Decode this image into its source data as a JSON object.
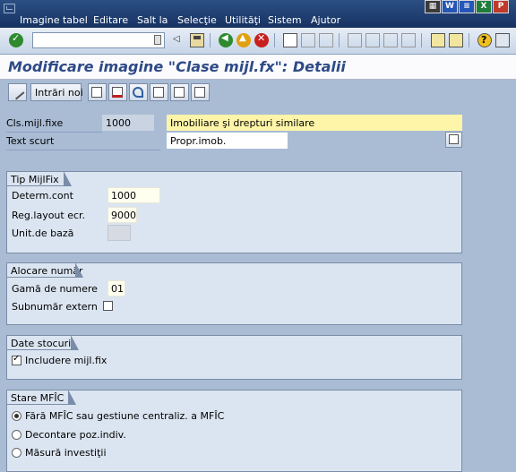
{
  "menu": {
    "items": [
      "Imagine tabel",
      "Editare",
      "Salt la",
      "Selecţie",
      "Utilităţi",
      "Sistem",
      "Ajutor"
    ]
  },
  "toolbar": {
    "command_value": ""
  },
  "title": "Modificare imagine \"Clase mijl.fx\": Detalii",
  "app_toolbar": {
    "new_entries_label": "Intrări noi"
  },
  "header": {
    "cls_label": "Cls.mijl.fixe",
    "cls_value": "1000",
    "cls_desc": "Imobiliare şi drepturi similare",
    "short_text_label": "Text scurt",
    "short_text_value": "Propr.imob."
  },
  "groups": {
    "tip": {
      "title": "Tip MijlFix",
      "determ_label": "Determ.cont",
      "determ_value": "1000",
      "layout_label": "Reg.layout ecr.",
      "layout_value": "9000",
      "unit_label": "Unit.de bază",
      "unit_value": ""
    },
    "alocare": {
      "title": "Alocare număr",
      "gama_label": "Gamă de numere",
      "gama_value": "01",
      "sub_label": "Subnumăr extern",
      "sub_checked": false
    },
    "stocuri": {
      "title": "Date stocuri",
      "include_label": "Includere mijl.fix",
      "include_checked": true
    },
    "stare": {
      "title": "Stare MFÎC",
      "options": [
        {
          "label": "Fără MFÎC sau gestiune centraliz. a MFÎC",
          "selected": true
        },
        {
          "label": "Decontare poz.indiv.",
          "selected": false
        },
        {
          "label": "Măsură investiţii",
          "selected": false
        }
      ]
    }
  },
  "colors": {
    "background": "#a9bcd4",
    "menubar": "#1f3c6e",
    "title": "#2e4a86",
    "group": "#dbe5f1",
    "highlight": "#fff5a8"
  }
}
